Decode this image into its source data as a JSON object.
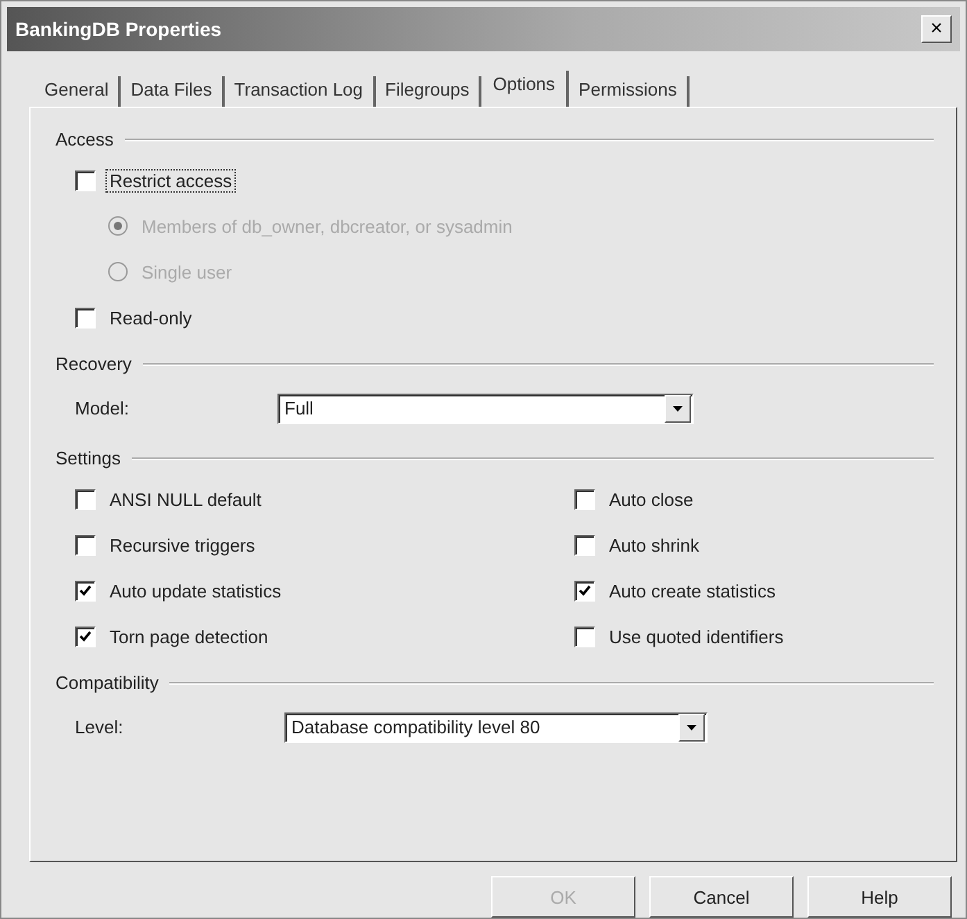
{
  "window": {
    "title": "BankingDB Properties",
    "close": "×"
  },
  "tabs": [
    {
      "label": "General",
      "selected": false
    },
    {
      "label": "Data Files",
      "selected": false
    },
    {
      "label": "Transaction Log",
      "selected": false
    },
    {
      "label": "Filegroups",
      "selected": false
    },
    {
      "label": "Options",
      "selected": true
    },
    {
      "label": "Permissions",
      "selected": false
    }
  ],
  "access": {
    "title": "Access",
    "items": [
      {
        "kind": "checkbox",
        "label": "Restrict access",
        "checked": false,
        "disabled": false,
        "focused": true
      },
      {
        "kind": "radio",
        "label": "Members of db_owner, dbcreator, or sysadmin",
        "selected": true,
        "disabled": true
      },
      {
        "kind": "radio",
        "label": "Single user",
        "selected": false,
        "disabled": true
      },
      {
        "kind": "checkbox",
        "label": "Read-only",
        "checked": false,
        "disabled": false,
        "focused": false
      }
    ]
  },
  "recovery": {
    "title": "Recovery",
    "label": "Model:",
    "value": "Full"
  },
  "settings": {
    "title": "Settings",
    "items": [
      {
        "label": "ANSI NULL default",
        "checked": false
      },
      {
        "label": "Auto close",
        "checked": false
      },
      {
        "label": "Recursive triggers",
        "checked": false
      },
      {
        "label": "Auto shrink",
        "checked": false
      },
      {
        "label": "Auto update statistics",
        "checked": true
      },
      {
        "label": "Auto create statistics",
        "checked": true
      },
      {
        "label": "Torn page detection",
        "checked": true
      },
      {
        "label": "Use quoted identifiers",
        "checked": false
      }
    ]
  },
  "compatibility": {
    "title": "Compatibility",
    "label": "Level:",
    "value": "Database compatibility level 80"
  },
  "buttons": [
    {
      "label": "OK",
      "disabled": true
    },
    {
      "label": "Cancel",
      "disabled": false
    },
    {
      "label": "Help",
      "disabled": false
    }
  ]
}
